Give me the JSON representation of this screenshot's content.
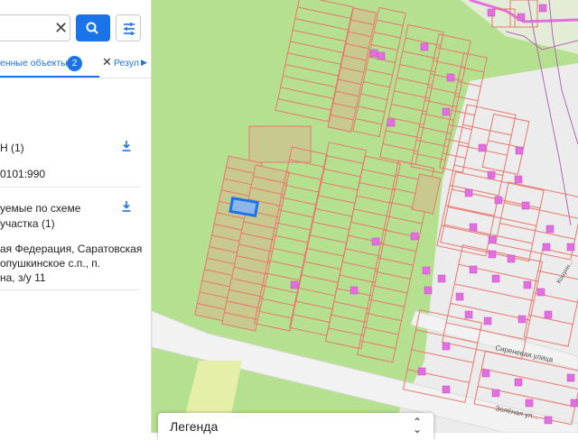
{
  "search": {
    "clear_icon": "close-icon",
    "button_icon": "search-icon",
    "filter_icon": "sliders-icon"
  },
  "tabs": {
    "active_label": "енные объекты",
    "count": "2",
    "second_label": "Резул",
    "close_icon": "close-icon",
    "more_icon": "chevron-right-icon"
  },
  "sections": [
    {
      "title": "Н (1)",
      "value": "0101:990",
      "download_icon": "download-icon"
    },
    {
      "title_lines": [
        "уемые по схеме",
        " участка (1)"
      ],
      "address_lines": [
        "ая Федерация, Саратовская",
        "опушкинское с.п., п.",
        "на, з/у 11"
      ],
      "download_icon": "download-icon"
    }
  ],
  "map": {
    "street_labels": [
      "Сиреневая улица",
      "Зелёная ул...",
      "Конунн..."
    ],
    "colors": {
      "base": "#b5e090",
      "parcel_fill": "#c8c98e",
      "parcel_stroke": "#e8776d",
      "building": "#e26ee0",
      "selected": "#1a73e8",
      "road": "#f2f2f2"
    }
  },
  "legend": {
    "title": "Легенда",
    "toggle_icon": "chevron-updown-icon"
  }
}
